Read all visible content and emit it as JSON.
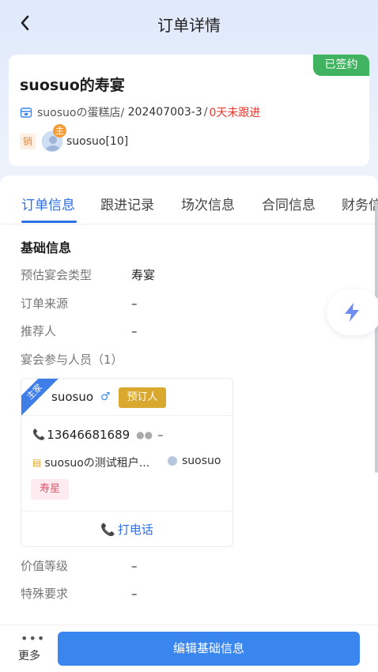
{
  "nav": {
    "title": "订单详情"
  },
  "summary": {
    "status_badge": "已签约",
    "order_name": "suosuo的寿宴",
    "store": "suosuoの蛋糕店/",
    "order_no": "202407003-3",
    "separator": "/",
    "follow_days": "0天未跟进",
    "sales_tag": "销",
    "main_mark": "主",
    "salesperson": "suosuo[10]"
  },
  "tabs": [
    {
      "label": "订单信息",
      "active": true
    },
    {
      "label": "跟进记录",
      "active": false
    },
    {
      "label": "场次信息",
      "active": false
    },
    {
      "label": "合同信息",
      "active": false
    },
    {
      "label": "财务信",
      "active": false
    }
  ],
  "basic_info": {
    "title": "基础信息",
    "fields": [
      {
        "label": "预估宴会类型",
        "value": "寿宴"
      },
      {
        "label": "订单来源",
        "value": "–"
      },
      {
        "label": "推荐人",
        "value": "–"
      }
    ],
    "participants_label": "宴会参与人员（1）"
  },
  "participant": {
    "host_ribbon": "主家",
    "name": "suosuo",
    "gender_symbol": "♂",
    "role_tag": "预订人",
    "phone": "13646681689",
    "wechat": "–",
    "tenant": "suosuoの测试租户...",
    "user": "suosuo",
    "guest_tag": "寿星",
    "call_label": "打电话"
  },
  "more_fields": [
    {
      "label": "价值等级",
      "value": "–"
    },
    {
      "label": "特殊要求",
      "value": "–"
    }
  ],
  "bottom": {
    "more_label": "更多",
    "edit_button": "编辑基础信息"
  },
  "colors": {
    "primary": "#2f6fe6",
    "signed": "#3fb35f",
    "overdue": "#e8372c",
    "booker": "#d8a82f"
  }
}
